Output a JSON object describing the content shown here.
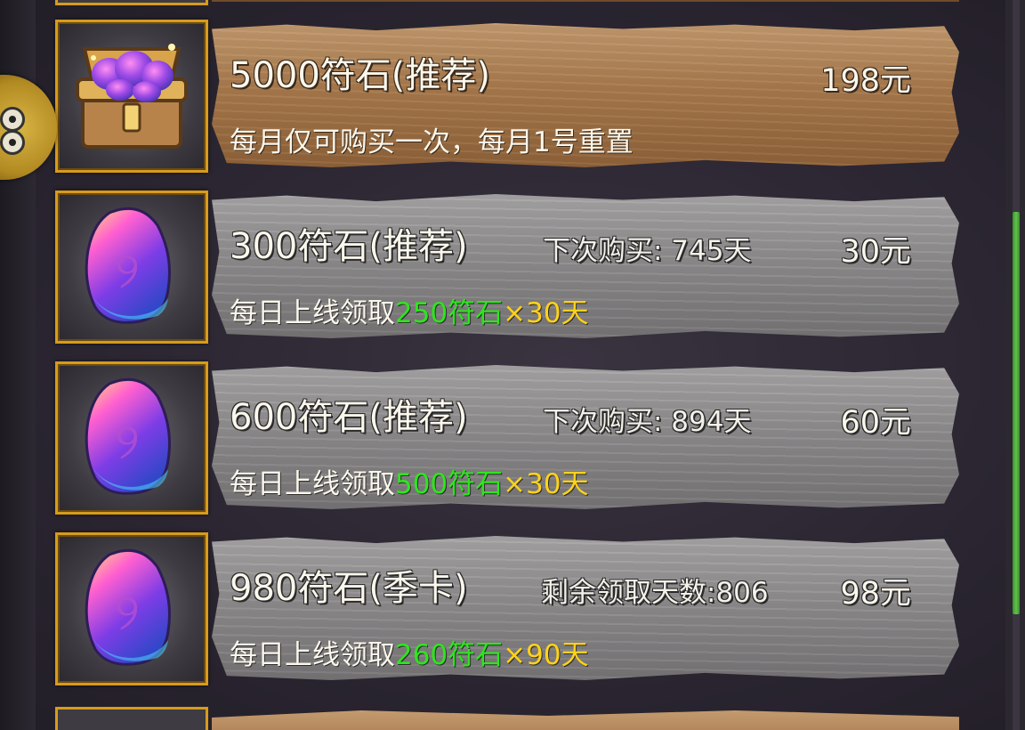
{
  "items": [
    {
      "title": "5000符石(推荐)",
      "status": "",
      "price": "198元",
      "desc_plain": "每月仅可购买一次，每月1号重置",
      "desc_prefix": "",
      "desc_green": "",
      "desc_yellow": "",
      "icon": "treasure-chest-of-runestones-icon",
      "style": "brown"
    },
    {
      "title": "300符石(推荐)",
      "status": "下次购买: 745天",
      "price": "30元",
      "desc_plain": "",
      "desc_prefix": "每日上线领取",
      "desc_green": "250符石",
      "desc_yellow": "×30天",
      "icon": "runestone-gem-icon",
      "style": "gray"
    },
    {
      "title": "600符石(推荐)",
      "status": "下次购买: 894天",
      "price": "60元",
      "desc_plain": "",
      "desc_prefix": "每日上线领取",
      "desc_green": "500符石",
      "desc_yellow": "×30天",
      "icon": "runestone-gem-icon",
      "style": "gray"
    },
    {
      "title": "980符石(季卡)",
      "status": "剩余领取天数:806",
      "price": "98元",
      "desc_plain": "",
      "desc_prefix": "每日上线领取",
      "desc_green": "260符石",
      "desc_yellow": "×90天",
      "icon": "runestone-gem-icon",
      "style": "gray"
    }
  ],
  "colors": {
    "frame_gold": "#d79b1c",
    "plank_brown": "#a8794c",
    "plank_gray": "#8f8d8e",
    "highlight_green": "#2ee51e",
    "highlight_yellow": "#ffd21a",
    "scrollbar_green": "#61c24a"
  }
}
